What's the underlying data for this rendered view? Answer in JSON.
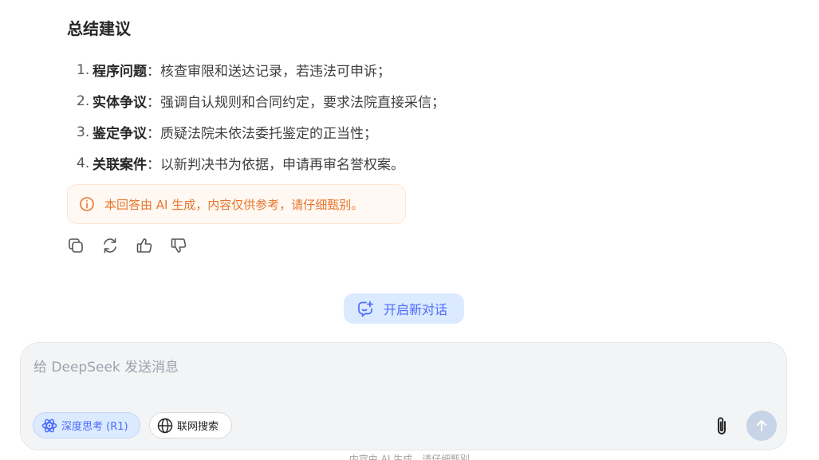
{
  "answer": {
    "section_title": "总结建议",
    "steps": [
      {
        "num": "1.",
        "term": "程序问题",
        "sep": "：",
        "desc": "核查审限和送达记录，若违法可申诉；"
      },
      {
        "num": "2.",
        "term": "实体争议",
        "sep": "：",
        "desc": "强调自认规则和合同约定，要求法院直接采信；"
      },
      {
        "num": "3.",
        "term": "鉴定争议",
        "sep": "：",
        "desc": "质疑法院未依法委托鉴定的正当性；"
      },
      {
        "num": "4.",
        "term": "关联案件",
        "sep": "：",
        "desc": "以新判决书为依据，申请再审名誉权案。"
      }
    ],
    "disclaimer": "本回答由 AI 生成，内容仅供参考，请仔细甄别。"
  },
  "actions": {
    "icons": [
      "copy-icon",
      "regenerate-icon",
      "thumbs-up-icon",
      "thumbs-down-icon"
    ]
  },
  "new_chat": {
    "label": "开启新对话",
    "icon": "new-chat-icon"
  },
  "composer": {
    "placeholder": "给 DeepSeek 发送消息",
    "value": "",
    "deep_think_label": "深度思考 (R1)",
    "web_search_label": "联网搜索",
    "accent": "#4d6bfe"
  },
  "footer": {
    "note": "内容由 AI 生成，请仔细甄别"
  }
}
